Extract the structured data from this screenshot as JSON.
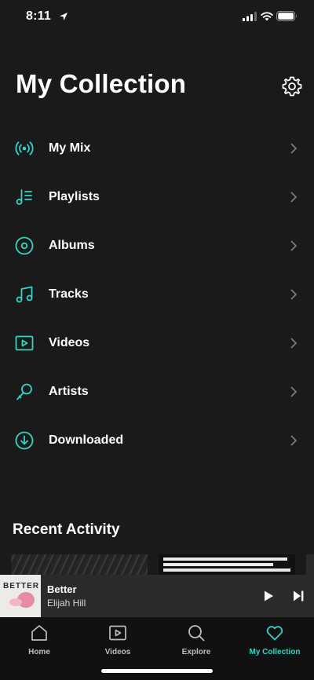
{
  "status_bar": {
    "time": "8:11"
  },
  "header": {
    "title": "My Collection"
  },
  "menu": {
    "items": [
      {
        "label": "My Mix",
        "icon": "radio-broadcast-icon"
      },
      {
        "label": "Playlists",
        "icon": "playlist-icon"
      },
      {
        "label": "Albums",
        "icon": "album-disc-icon"
      },
      {
        "label": "Tracks",
        "icon": "music-note-icon"
      },
      {
        "label": "Videos",
        "icon": "video-play-icon"
      },
      {
        "label": "Artists",
        "icon": "microphone-icon"
      },
      {
        "label": "Downloaded",
        "icon": "download-circle-icon"
      }
    ]
  },
  "recent": {
    "title": "Recent Activity"
  },
  "now_playing": {
    "title": "Better",
    "artist": "Elijah Hill",
    "album_art_text": "BETTER"
  },
  "tabs": [
    {
      "label": "Home",
      "icon": "home-icon",
      "active": false
    },
    {
      "label": "Videos",
      "icon": "video-icon",
      "active": false
    },
    {
      "label": "Explore",
      "icon": "search-icon",
      "active": false
    },
    {
      "label": "My Collection",
      "icon": "heart-icon",
      "active": true
    }
  ],
  "colors": {
    "accent": "#33d4c6",
    "background": "#1a1a1a",
    "player": "#2b2b2b",
    "tab_bar": "#111111"
  }
}
